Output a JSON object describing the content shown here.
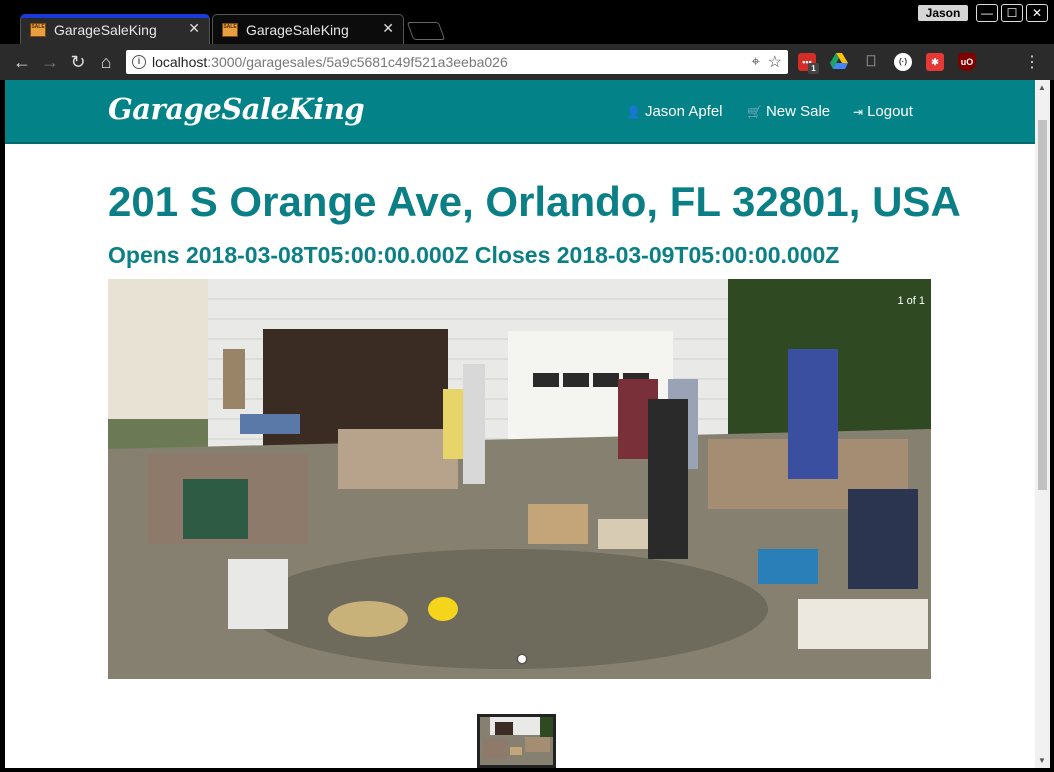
{
  "browser": {
    "tabs": [
      {
        "title": "GarageSaleKing",
        "active": true
      },
      {
        "title": "GarageSaleKing",
        "active": false
      }
    ],
    "profile_name": "Jason",
    "window_controls": {
      "minimize": "—",
      "maximize": "☐",
      "close": "✕"
    },
    "url_host": "localhost",
    "url_path": ":3000/garagesales/5a9c5681c49f521a3eeba026",
    "extensions": [
      {
        "icon": "lastpass-icon",
        "badge": "1",
        "color": "#d32d27"
      },
      {
        "icon": "google-drive-icon",
        "color": "#1fa463"
      },
      {
        "icon": "bookmark-icon",
        "color": "#888888"
      },
      {
        "icon": "extension-icon",
        "color": "#ffffff"
      },
      {
        "icon": "red-extension-icon",
        "color": "#e53935"
      },
      {
        "icon": "ublock-icon",
        "color": "#800000"
      }
    ]
  },
  "navbar": {
    "brand": "GarageSaleKing",
    "links": [
      {
        "icon": "user-icon",
        "label": "Jason Apfel"
      },
      {
        "icon": "cart-icon",
        "label": "New Sale"
      },
      {
        "icon": "logout-icon",
        "label": "Logout"
      }
    ]
  },
  "sale": {
    "address": "201 S Orange Ave, Orlando, FL 32801, USA",
    "hours": "Opens 2018-03-08T05:00:00.000Z Closes 2018-03-09T05:00:00.000Z",
    "carousel_counter": "1 of 1"
  },
  "colors": {
    "teal": "#038388",
    "heading_teal": "#0b7f86",
    "tab_accent": "#1a3bd8"
  }
}
